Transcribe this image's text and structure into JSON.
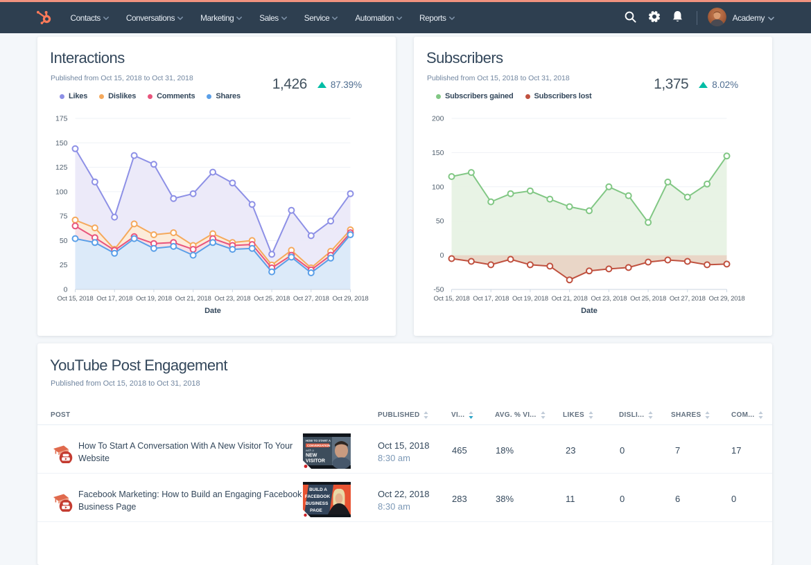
{
  "navbar": {
    "menu": [
      {
        "label": "Contacts"
      },
      {
        "label": "Conversations"
      },
      {
        "label": "Marketing"
      },
      {
        "label": "Sales"
      },
      {
        "label": "Service"
      },
      {
        "label": "Automation"
      },
      {
        "label": "Reports"
      }
    ],
    "icons": [
      "search",
      "settings",
      "notifications"
    ],
    "account": {
      "label": "Academy"
    },
    "brand_color": "#ff7a59",
    "background_color": "#2e3f50",
    "accent_color": "#f1927e"
  },
  "interactions": {
    "title": "Interactions",
    "subtitle": "Published from Oct 15, 2018 to Oct 31, 2018",
    "total": "1,426",
    "delta": "87.39%",
    "delta_direction": "up",
    "delta_color": "#00bda5"
  },
  "subscribers": {
    "title": "Subscribers",
    "subtitle": "Published from Oct 15, 2018 to Oct 31, 2018",
    "total": "1,375",
    "delta": "8.02%",
    "delta_direction": "up",
    "delta_color": "#00bda5"
  },
  "engagement": {
    "title": "YouTube Post Engagement",
    "subtitle": "Published from Oct 15, 2018 to Oct 31, 2018",
    "columns": [
      {
        "label": "POST",
        "sortable": false
      },
      {
        "label": "PUBLISHED",
        "sortable": true
      },
      {
        "label": "VI...",
        "sortable": true,
        "sorted": "desc"
      },
      {
        "label": "AVG. % VI...",
        "sortable": true
      },
      {
        "label": "LIKES",
        "sortable": true
      },
      {
        "label": "DISLI...",
        "sortable": true
      },
      {
        "label": "SHARES",
        "sortable": true
      },
      {
        "label": "COM...",
        "sortable": true
      }
    ],
    "sort_active_color": "#26a2c6",
    "rows": [
      {
        "title": "How To Start A Conversation With A New Visitor To Your Website",
        "published_date": "Oct 15, 2018",
        "published_time": "8:30 am",
        "views": "465",
        "avg_pct_viewed": "18%",
        "likes": "23",
        "dislikes": "0",
        "shares": "7",
        "comments": "17",
        "thumbnail": {
          "style": "dark",
          "lines": [
            "HOW TO START A",
            "CONVERSATION",
            "with a",
            "NEW VISITOR"
          ]
        }
      },
      {
        "title": "Facebook Marketing: How to Build an Engaging Facebook Business Page",
        "published_date": "Oct 22, 2018",
        "published_time": "8:30 am",
        "views": "283",
        "avg_pct_viewed": "38%",
        "likes": "11",
        "dislikes": "0",
        "shares": "6",
        "comments": "0",
        "thumbnail": {
          "style": "orange",
          "lines": [
            "BUILD A",
            "FACEBOOK",
            "BUSINESS",
            "PAGE"
          ]
        }
      }
    ]
  },
  "chart_data": [
    {
      "type": "line",
      "title": "Interactions",
      "x": [
        "Oct 15, 2018",
        "Oct 16, 2018",
        "Oct 17, 2018",
        "Oct 18, 2018",
        "Oct 19, 2018",
        "Oct 20, 2018",
        "Oct 21, 2018",
        "Oct 22, 2018",
        "Oct 23, 2018",
        "Oct 24, 2018",
        "Oct 25, 2018",
        "Oct 26, 2018",
        "Oct 27, 2018",
        "Oct 28, 2018",
        "Oct 29, 2018"
      ],
      "xlabel": "Date",
      "ylim": [
        0,
        175
      ],
      "yticks": [
        0,
        25,
        50,
        75,
        100,
        125,
        150,
        175
      ],
      "x_tick_label_every": 2,
      "grid": true,
      "legend_position": "top-left",
      "series": [
        {
          "name": "Likes",
          "color": "#8d90e6",
          "fill": "#eae8f8",
          "values": [
            144,
            110,
            74,
            137,
            128,
            93,
            98,
            120,
            109,
            87,
            36,
            81,
            55,
            70,
            98
          ]
        },
        {
          "name": "Dislikes",
          "color": "#f5a95c",
          "fill": "#fdebd7",
          "values": [
            71,
            63,
            41,
            67,
            56,
            58,
            45,
            57,
            48,
            50,
            25,
            40,
            22,
            39,
            61
          ]
        },
        {
          "name": "Comments",
          "color": "#e8547c",
          "fill": "#f9dee6",
          "values": [
            65,
            53,
            40,
            54,
            47,
            48,
            41,
            52,
            45,
            46,
            22,
            35,
            20,
            35,
            58
          ]
        },
        {
          "name": "Shares",
          "color": "#5a9fe8",
          "fill": "#d9eafb",
          "values": [
            52,
            48,
            37,
            52,
            42,
            44,
            35,
            48,
            41,
            42,
            18,
            33,
            17,
            32,
            56
          ]
        }
      ]
    },
    {
      "type": "line",
      "title": "Subscribers",
      "x": [
        "Oct 15, 2018",
        "Oct 16, 2018",
        "Oct 17, 2018",
        "Oct 18, 2018",
        "Oct 19, 2018",
        "Oct 20, 2018",
        "Oct 21, 2018",
        "Oct 22, 2018",
        "Oct 23, 2018",
        "Oct 24, 2018",
        "Oct 25, 2018",
        "Oct 26, 2018",
        "Oct 27, 2018",
        "Oct 28, 2018",
        "Oct 29, 2018"
      ],
      "xlabel": "Date",
      "ylim": [
        -50,
        200
      ],
      "yticks": [
        -50,
        0,
        50,
        100,
        150,
        200
      ],
      "x_tick_label_every": 2,
      "grid": true,
      "legend_position": "top-left",
      "series": [
        {
          "name": "Subscribers gained",
          "color": "#81c784",
          "fill": "#e6f2e3",
          "values": [
            115,
            121,
            78,
            90,
            94,
            82,
            71,
            65,
            100,
            87,
            48,
            107,
            85,
            104,
            145
          ]
        },
        {
          "name": "Subscribers lost",
          "color": "#c0513f",
          "fill": "#e7d2c2",
          "values": [
            -5,
            -9,
            -14,
            -6,
            -14,
            -16,
            -36,
            -23,
            -20,
            -18,
            -10,
            -7,
            -9,
            -14,
            -13
          ]
        }
      ]
    }
  ]
}
